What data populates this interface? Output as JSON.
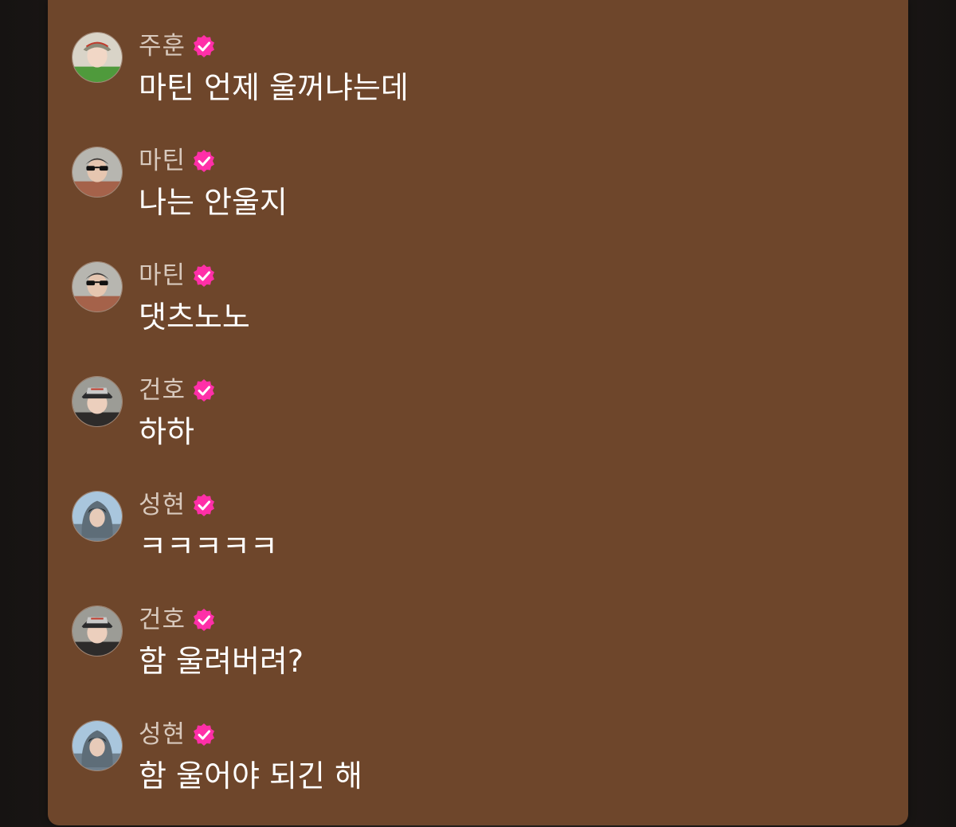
{
  "messages": [
    {
      "name": "주훈",
      "text": "마틴 언제 울꺼냐는데",
      "avatar": "avatar-juhoon"
    },
    {
      "name": "마틴",
      "text": "나는 안울지",
      "avatar": "avatar-martin"
    },
    {
      "name": "마틴",
      "text": "댓츠노노",
      "avatar": "avatar-martin"
    },
    {
      "name": "건호",
      "text": "하하",
      "avatar": "avatar-geonho"
    },
    {
      "name": "성현",
      "text": "ㅋㅋㅋㅋㅋ",
      "avatar": "avatar-seonghyeon"
    },
    {
      "name": "건호",
      "text": "함 울려버려?",
      "avatar": "avatar-geonho"
    },
    {
      "name": "성현",
      "text": "함 울어야 되긴 해",
      "avatar": "avatar-seonghyeon"
    }
  ],
  "colors": {
    "panel": "#6e462b",
    "name": "#d8c9bd",
    "message": "#ffffff",
    "badge": "#ff2fa8"
  },
  "icons": {
    "verified": "verified-badge-icon"
  }
}
